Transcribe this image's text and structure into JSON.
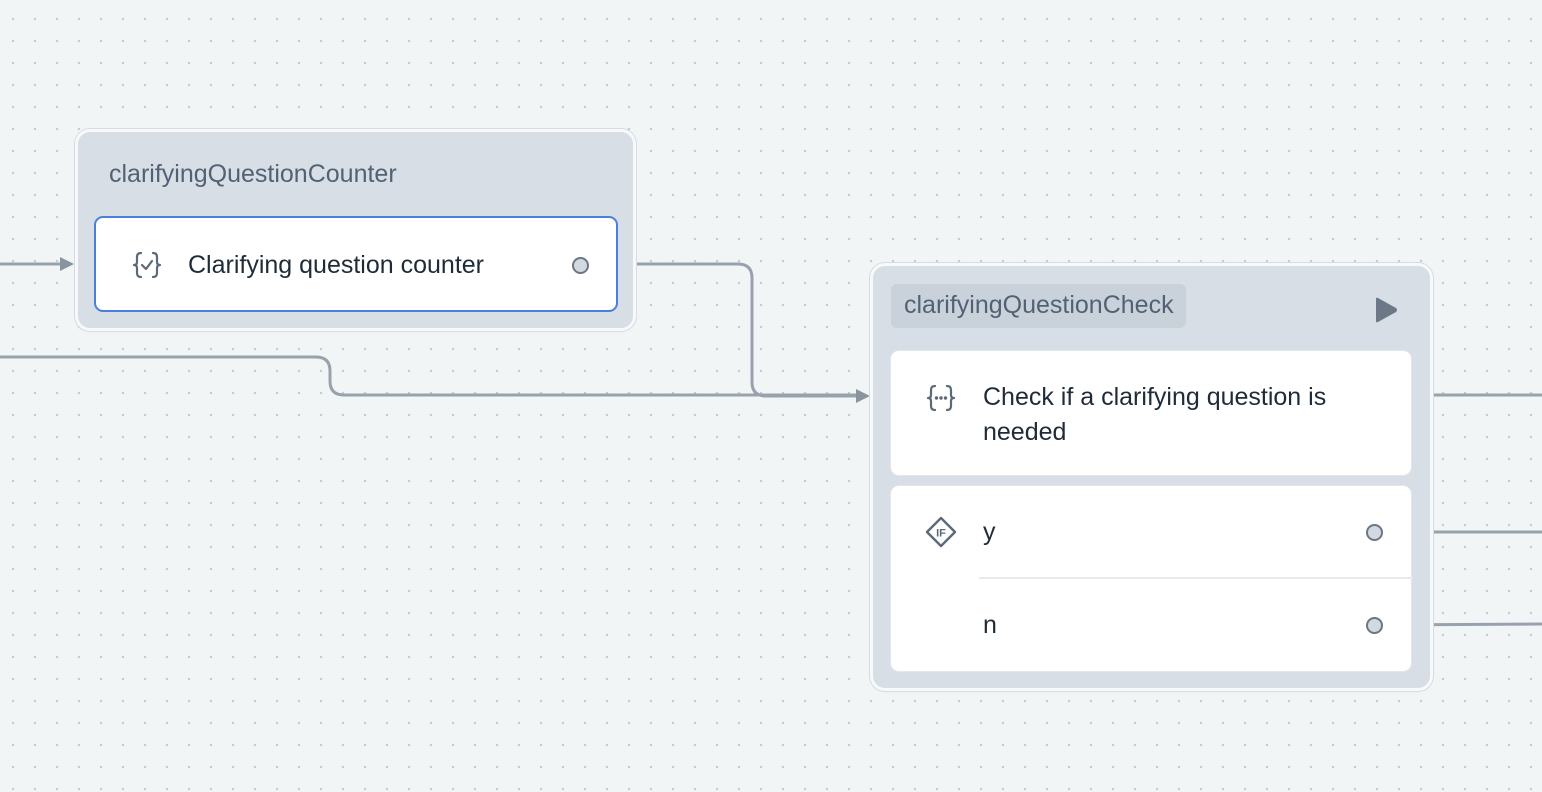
{
  "counter_block": {
    "title": "clarifyingQuestionCounter",
    "step": {
      "label": "Clarifying question counter",
      "icon": "code-check-icon"
    }
  },
  "check_block": {
    "title": "clarifyingQuestionCheck",
    "run_icon": "play-icon",
    "step": {
      "label": "Check if a clarifying question is needed",
      "icon": "code-ellipsis-icon"
    },
    "condition": {
      "icon": "if-diamond-icon",
      "paths": [
        {
          "label": "y"
        },
        {
          "label": "n"
        }
      ]
    }
  },
  "colors": {
    "canvas_background": "#f2f5f6",
    "block_background": "#d8dee5",
    "selected_border": "#4a7fdc",
    "edge": "#98a2ad"
  }
}
